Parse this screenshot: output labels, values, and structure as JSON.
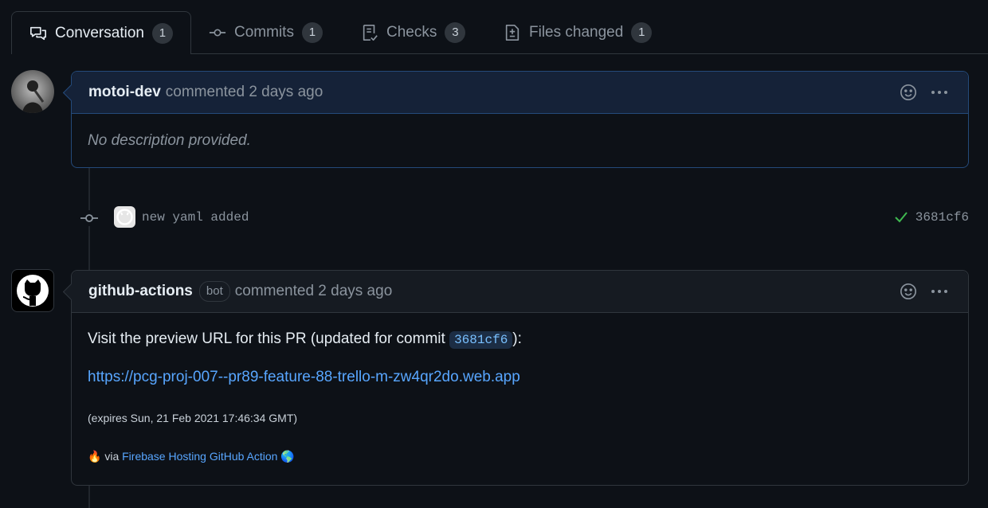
{
  "tabs": [
    {
      "label": "Conversation",
      "count": "1",
      "icon": "comment-discussion-icon"
    },
    {
      "label": "Commits",
      "count": "1",
      "icon": "git-commit-icon"
    },
    {
      "label": "Checks",
      "count": "3",
      "icon": "checklist-icon"
    },
    {
      "label": "Files changed",
      "count": "1",
      "icon": "file-diff-icon"
    }
  ],
  "comment1": {
    "author": "motoi-dev",
    "meta": "commented 2 days ago",
    "body": "No description provided."
  },
  "commit": {
    "message": "new yaml added",
    "sha": "3681cf6",
    "status": "success"
  },
  "comment2": {
    "author": "github-actions",
    "badge": "bot",
    "meta": "commented 2 days ago",
    "line1_pre": "Visit the preview URL for this PR (updated for commit",
    "line1_sha": "3681cf6",
    "line1_post": "):",
    "url": "https://pcg-proj-007--pr89-feature-88-trello-m-zw4qr2do.web.app",
    "expires": "(expires Sun, 21 Feb 2021 17:46:34 GMT)",
    "footer_emoji_start": "🔥",
    "footer_via": "via",
    "footer_link": "Firebase Hosting GitHub Action",
    "footer_emoji_end": "🌎"
  },
  "colors": {
    "background": "#0d1117",
    "link": "#58a6ff",
    "success": "#3fb950",
    "muted": "#8b949e"
  }
}
